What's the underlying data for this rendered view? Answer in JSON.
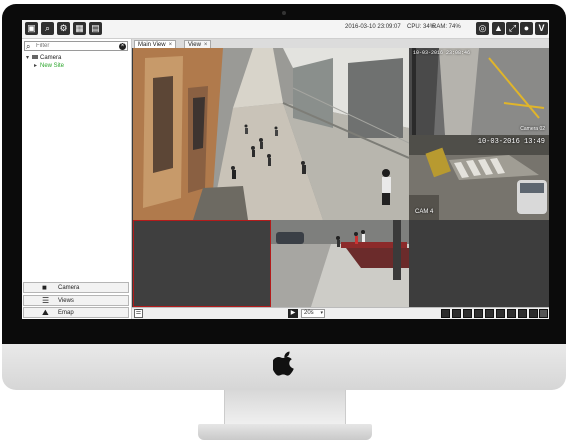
{
  "toolbar": {
    "buttons": [
      {
        "name": "live-view-icon",
        "glyph": "▣"
      },
      {
        "name": "search-playback-icon",
        "glyph": "⌕"
      },
      {
        "name": "settings-gear-icon",
        "glyph": "⚙"
      },
      {
        "name": "layout-grid-icon",
        "glyph": "▦"
      },
      {
        "name": "video-wall-icon",
        "glyph": "▤"
      }
    ],
    "datetime": "2016-03-10 23:09:07",
    "cpu": "CPU: 34%",
    "ram": "RAM: 74%",
    "right_buttons": [
      {
        "name": "headset-icon",
        "glyph": "◎"
      },
      {
        "name": "alarm-bell-icon",
        "glyph": "▲"
      },
      {
        "name": "fullscreen-icon",
        "glyph": "⤢"
      },
      {
        "name": "user-icon",
        "glyph": "●"
      },
      {
        "name": "brand-logo-icon",
        "glyph": "V"
      }
    ]
  },
  "sidebar": {
    "search_placeholder": "Filter",
    "tree": {
      "root_label": "Camera",
      "child_label": "New Site"
    },
    "nav": [
      {
        "label": "Camera",
        "icon": "camera-icon",
        "glyph": "■"
      },
      {
        "label": "Views",
        "icon": "views-list-icon",
        "glyph": "☰"
      },
      {
        "label": "Emap",
        "icon": "emap-icon",
        "glyph": "⛰"
      }
    ]
  },
  "tabs": [
    {
      "label": "Main View",
      "close": "×"
    },
    {
      "label": "View",
      "close": "×"
    }
  ],
  "tiles": {
    "tile2_time": "10-03-2016 23:08:46",
    "tile2_label": "Camera 02",
    "tile3_time": "10-03-2016 13:49",
    "tile3_label": "CAM 4"
  },
  "bottom": {
    "list_glyph": "☰",
    "play_glyph": "▶",
    "speed": "20s",
    "speed_arrow": "▾"
  },
  "colors": {
    "selected_cell_border": "#b31b1b",
    "tree_child": "#2aa52a"
  }
}
